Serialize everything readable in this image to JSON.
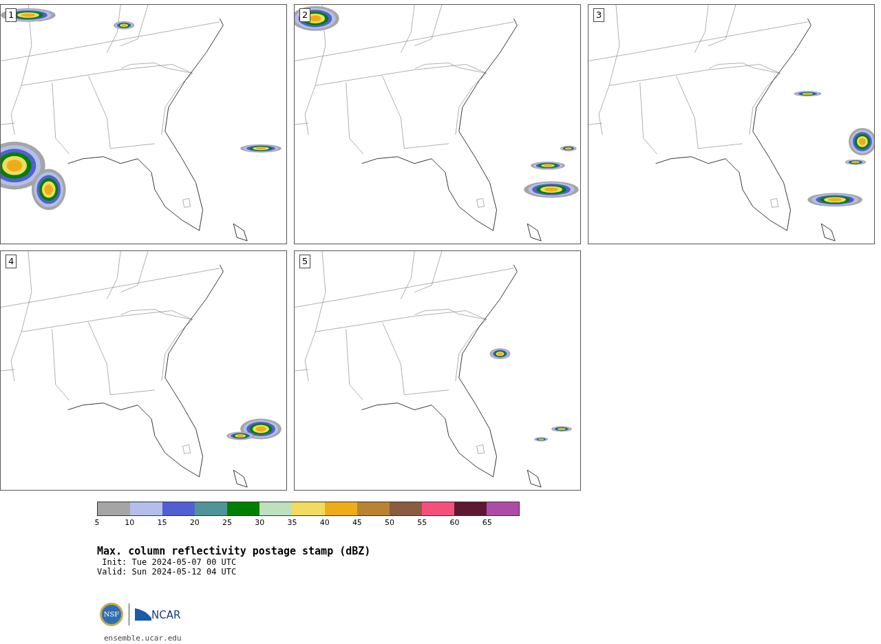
{
  "panels": [
    {
      "label": "1"
    },
    {
      "label": "2"
    },
    {
      "label": "3"
    },
    {
      "label": "4"
    },
    {
      "label": "5"
    }
  ],
  "colorbar": {
    "bins": [
      {
        "color": "#a5a5a5",
        "tick": "5"
      },
      {
        "color": "#b4bfe9",
        "tick": "10"
      },
      {
        "color": "#525fd4",
        "tick": "15"
      },
      {
        "color": "#4f9598",
        "tick": "20"
      },
      {
        "color": "#008000",
        "tick": "25"
      },
      {
        "color": "#bde0bf",
        "tick": "30"
      },
      {
        "color": "#f0dc5e",
        "tick": "35"
      },
      {
        "color": "#efac1a",
        "tick": "40"
      },
      {
        "color": "#b98331",
        "tick": "45"
      },
      {
        "color": "#8b5d40",
        "tick": "50"
      },
      {
        "color": "#f5507c",
        "tick": "55"
      },
      {
        "color": "#5f1732",
        "tick": "60"
      },
      {
        "color": "#ad4ca6",
        "tick": "65"
      }
    ]
  },
  "title": "Max. column reflectivity postage stamp (dBZ)",
  "init": " Init: Tue 2024-05-07 00 UTC",
  "valid": "Valid: Sun 2024-05-12 04 UTC",
  "logos": {
    "nsf": "NSF",
    "ncar": "NCAR"
  },
  "url": "ensemble.ucar.edu"
}
